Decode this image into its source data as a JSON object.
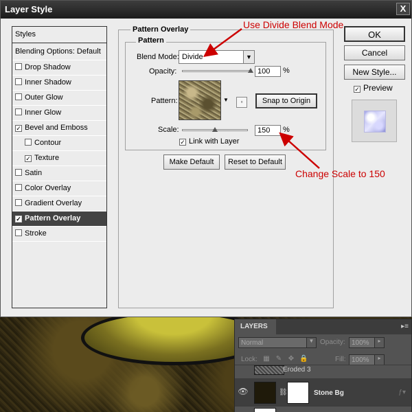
{
  "dialog": {
    "title": "Layer Style",
    "close_label": "X"
  },
  "styles_panel": {
    "header": "Styles",
    "blending_options": "Blending Options: Default",
    "items": [
      {
        "label": "Drop Shadow",
        "checked": false,
        "indent": false,
        "selected": false
      },
      {
        "label": "Inner Shadow",
        "checked": false,
        "indent": false,
        "selected": false
      },
      {
        "label": "Outer Glow",
        "checked": false,
        "indent": false,
        "selected": false
      },
      {
        "label": "Inner Glow",
        "checked": false,
        "indent": false,
        "selected": false
      },
      {
        "label": "Bevel and Emboss",
        "checked": true,
        "indent": false,
        "selected": false
      },
      {
        "label": "Contour",
        "checked": false,
        "indent": true,
        "selected": false
      },
      {
        "label": "Texture",
        "checked": true,
        "indent": true,
        "selected": false
      },
      {
        "label": "Satin",
        "checked": false,
        "indent": false,
        "selected": false
      },
      {
        "label": "Color Overlay",
        "checked": false,
        "indent": false,
        "selected": false
      },
      {
        "label": "Gradient Overlay",
        "checked": false,
        "indent": false,
        "selected": false
      },
      {
        "label": "Pattern Overlay",
        "checked": true,
        "indent": false,
        "selected": true
      },
      {
        "label": "Stroke",
        "checked": false,
        "indent": false,
        "selected": false
      }
    ]
  },
  "pattern_overlay": {
    "group_title": "Pattern Overlay",
    "subgroup_title": "Pattern",
    "blend_mode_label": "Blend Mode:",
    "blend_mode_value": "Divide",
    "opacity_label": "Opacity:",
    "opacity_value": "100",
    "opacity_fraction": 1.0,
    "percent_sign": "%",
    "pattern_label": "Pattern:",
    "snap_to_origin_label": "Snap to Origin",
    "scale_label": "Scale:",
    "scale_value": "150",
    "scale_fraction": 0.5,
    "link_with_layer_label": "Link with Layer",
    "link_with_layer_checked": true,
    "make_default_label": "Make Default",
    "reset_to_default_label": "Reset to Default"
  },
  "right_panel": {
    "ok_label": "OK",
    "cancel_label": "Cancel",
    "new_style_label": "New Style...",
    "preview_label": "Preview",
    "preview_checked": true
  },
  "annotations": {
    "blend_mode_note": "Use Divide Blend Mode",
    "scale_note": "Change Scale to 150",
    "color": "#cc0000"
  },
  "layers_panel": {
    "tab_label": "LAYERS",
    "blend_mode": "Normal",
    "opacity_label": "Opacity:",
    "opacity_value": "100%",
    "lock_label": "Lock:",
    "fill_label": "Fill:",
    "fill_value": "100%",
    "layers": [
      {
        "name": "Eroded 3",
        "active": false
      },
      {
        "name": "Stone Bg",
        "active": true
      }
    ]
  }
}
